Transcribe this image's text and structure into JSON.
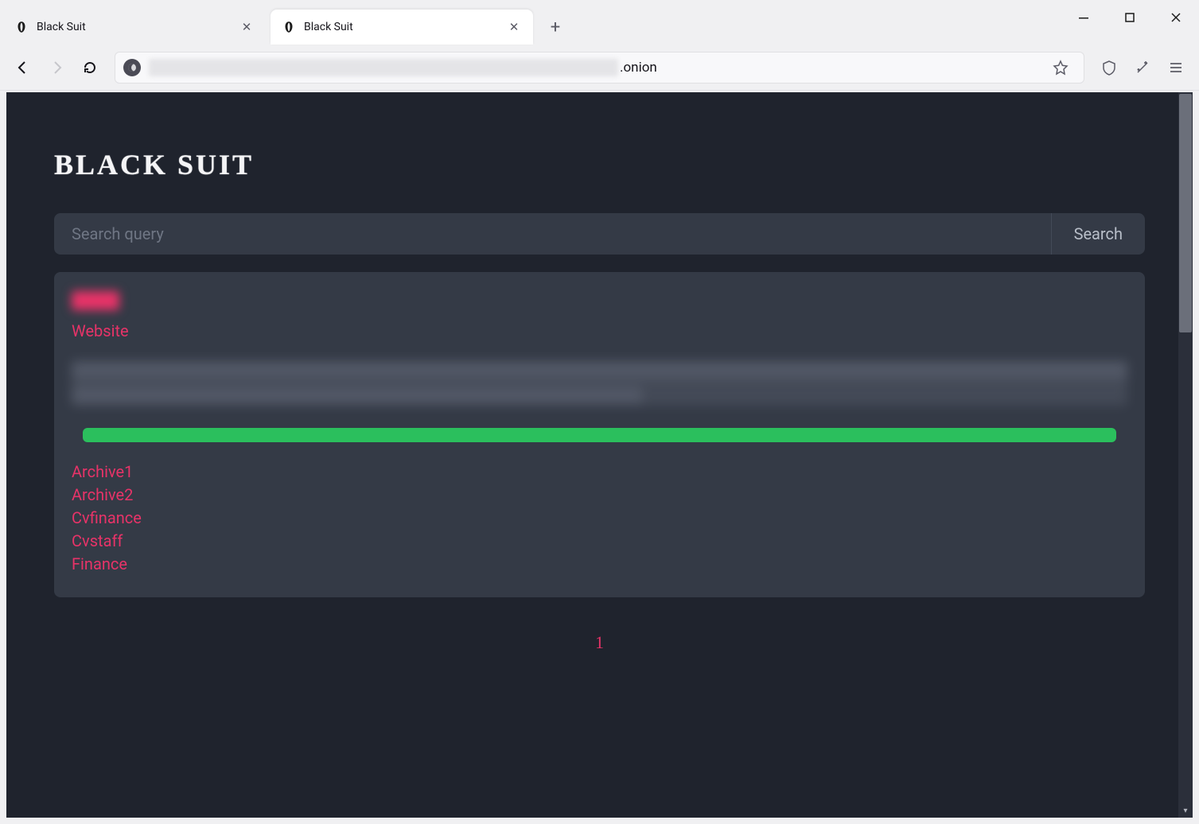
{
  "browser": {
    "tabs": [
      {
        "title": "Black Suit",
        "active": false
      },
      {
        "title": "Black Suit",
        "active": true
      }
    ],
    "url_suffix": ".onion"
  },
  "page": {
    "logo": "BLACK SUIT",
    "search": {
      "placeholder": "Search query",
      "button": "Search"
    },
    "card": {
      "website_label": "Website",
      "links": [
        "Archive1",
        "Archive2",
        "Cvfinance",
        "Cvstaff",
        "Finance"
      ]
    },
    "pagination": {
      "current": "1"
    }
  }
}
